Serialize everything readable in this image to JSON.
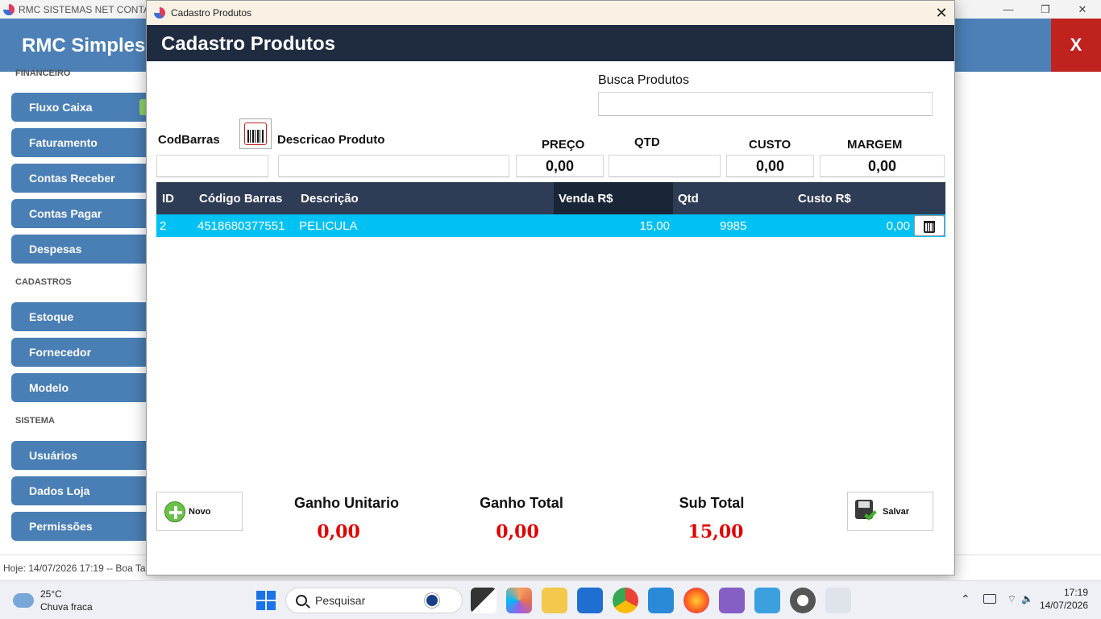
{
  "main_window": {
    "title": "RMC SISTEMAS NET CONTATO",
    "app_name": "RMC Simples",
    "close_label": "X",
    "window_controls": [
      "—",
      "❐",
      "✕"
    ]
  },
  "sidebar": {
    "sections": [
      {
        "label": "FINANCEIRO"
      },
      {
        "label": "CADASTROS"
      },
      {
        "label": "SISTEMA"
      }
    ],
    "items": [
      {
        "label": "Fluxo Caixa"
      },
      {
        "label": "Faturamento"
      },
      {
        "label": "Contas Receber"
      },
      {
        "label": "Contas Pagar"
      },
      {
        "label": "Despesas"
      },
      {
        "label": "Estoque"
      },
      {
        "label": "Fornecedor"
      },
      {
        "label": "Modelo"
      },
      {
        "label": "Usuários"
      },
      {
        "label": "Dados Loja"
      },
      {
        "label": "Permissões"
      }
    ]
  },
  "status_bar": {
    "text": "Hoje: 14/07/2026 17:19  --  Boa Ta"
  },
  "dialog": {
    "window_title": "Cadastro Produtos",
    "header": "Cadastro Produtos",
    "close_glyph": "✕",
    "search_label": "Busca Produtos",
    "search_value": "",
    "fields": {
      "codbarras_label": "CodBarras",
      "descricao_label": "Descricao Produto",
      "preco_label": "PREÇO",
      "preco_value": "0,00",
      "qtd_label": "QTD",
      "qtd_value": "",
      "custo_label": "CUSTO",
      "custo_value": "0,00",
      "margem_label": "MARGEM",
      "margem_value": "0,00"
    },
    "grid": {
      "columns": [
        "ID",
        "Código Barras",
        "Descrição",
        "Venda R$",
        "Qtd",
        "Custo R$"
      ],
      "rows": [
        {
          "id": "2",
          "codigo": "4518680377551",
          "descricao": "PELICULA",
          "venda": "15,00",
          "qtd": "9985",
          "custo": "0,00"
        }
      ]
    },
    "buttons": {
      "novo": "Novo",
      "salvar": "Salvar"
    },
    "summary": {
      "ganho_unitario_label": "Ganho Unitario",
      "ganho_unitario_value": "0,00",
      "ganho_total_label": "Ganho Total",
      "ganho_total_value": "0,00",
      "sub_total_label": "Sub Total",
      "sub_total_value": "15,00"
    }
  },
  "taskbar": {
    "weather_temp": "25°C",
    "weather_desc": "Chuva fraca",
    "search_placeholder": "Pesquisar",
    "time": "17:19",
    "date": "14/07/2026",
    "apps": [
      "task-view",
      "copilot",
      "file-explorer",
      "store",
      "chrome",
      "vscode",
      "firefox",
      "visual-studio",
      "notepad",
      "settings",
      "rmc-app"
    ]
  },
  "colors": {
    "header_blue": "#4c80b7",
    "dialog_header": "#1f2b3f",
    "grid_header": "#2e3d55",
    "selected_row": "#00c1f3",
    "summary_red": "#e00000",
    "close_red": "#c0221e"
  }
}
